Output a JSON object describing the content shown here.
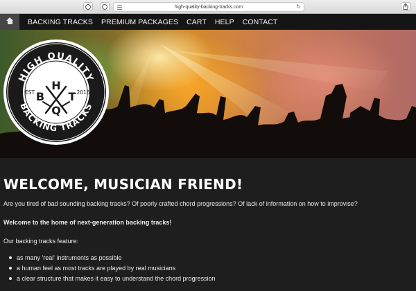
{
  "browser": {
    "url": "high-quality-backing-tracks.com",
    "icons": [
      "sidebar-icon",
      "info-icon",
      "reader-menu-icon",
      "reload-icon",
      "share-icon"
    ]
  },
  "nav": {
    "home_icon": "home-icon",
    "links": [
      "BACKING TRACKS",
      "PREMIUM PACKAGES",
      "CART",
      "HELP",
      "CONTACT"
    ]
  },
  "logo": {
    "top_text": "HIGH QUALITY",
    "bottom_text": "BACKING TRACKS",
    "left_text": "EST",
    "right_text": "2016",
    "letters": [
      "H",
      "B",
      "T",
      "Q"
    ]
  },
  "main": {
    "heading": "WELCOME, MUSICIAN FRIEND!",
    "intro": "Are you tired of bad sounding backing tracks? Of poorly crafted chord progressions? Of lack of information on how to improvise?",
    "tagline": "Welcome to the home of next-generation backing tracks!",
    "features_intro": "Our backing tracks feature:",
    "features": [
      "as many 'real' instruments as possible",
      "a human feel as most tracks are played by real musicians",
      "a clear structure that makes it easy to understand the chord progression"
    ]
  }
}
